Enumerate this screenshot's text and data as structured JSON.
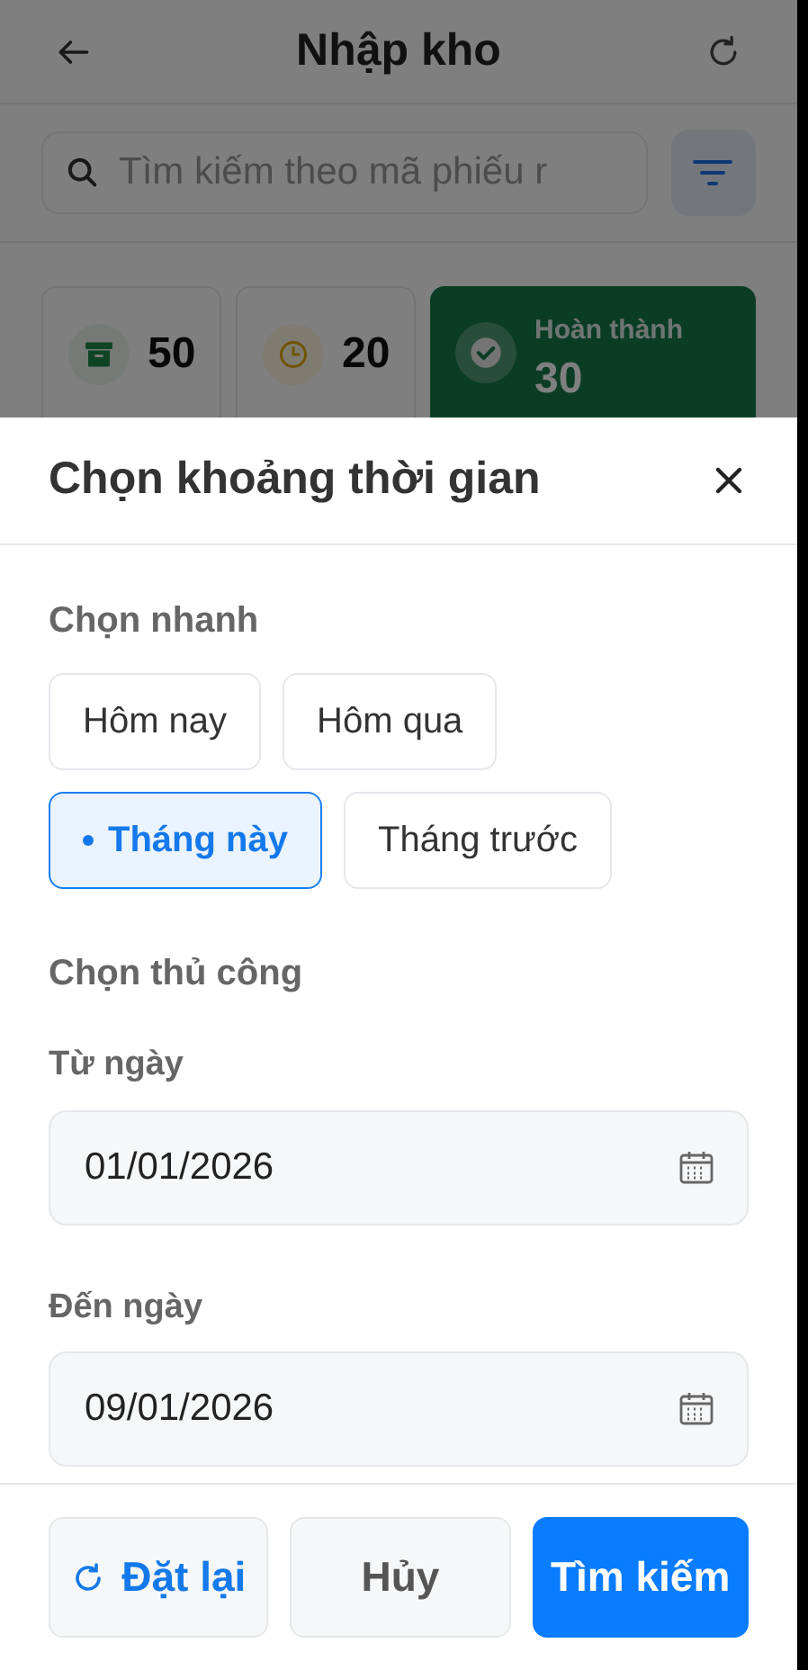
{
  "header": {
    "title": "Nhập kho"
  },
  "search": {
    "placeholder": "Tìm kiếm theo mã phiếu r"
  },
  "stats": [
    {
      "kind": "total",
      "value": "50",
      "selected": false
    },
    {
      "kind": "pending",
      "value": "20",
      "selected": false
    },
    {
      "kind": "done",
      "label": "Hoàn thành",
      "value": "30",
      "selected": true
    }
  ],
  "sheet": {
    "title": "Chọn khoảng thời gian",
    "quick_label": "Chọn nhanh",
    "quick_options": [
      {
        "label": "Hôm nay",
        "selected": false
      },
      {
        "label": "Hôm qua",
        "selected": false
      },
      {
        "label": "Tháng này",
        "selected": true
      },
      {
        "label": "Tháng trước",
        "selected": false
      }
    ],
    "manual_label": "Chọn thủ công",
    "fields": [
      {
        "label": "Từ ngày",
        "value": "01/01/2026"
      },
      {
        "label": "Đến ngày",
        "value": "09/01/2026"
      }
    ],
    "buttons": [
      {
        "kind": "reset",
        "label": "Đặt lại"
      },
      {
        "kind": "cancel",
        "label": "Hủy"
      },
      {
        "kind": "search",
        "label": "Tìm kiếm"
      }
    ]
  }
}
